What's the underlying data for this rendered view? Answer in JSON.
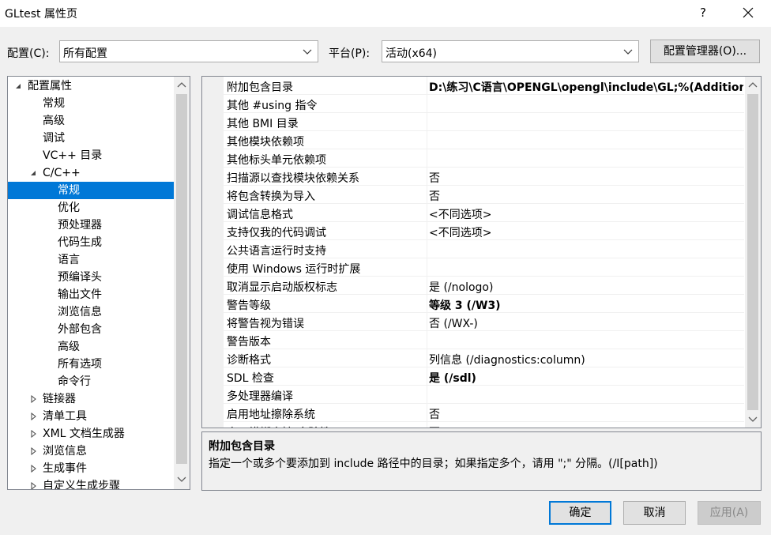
{
  "window": {
    "title": "GLtest 属性页"
  },
  "titlebar": {
    "help": "?"
  },
  "config": {
    "label": "配置(C):",
    "value": "所有配置"
  },
  "platform": {
    "label": "平台(P):",
    "value": "活动(x64)"
  },
  "manager_button": "配置管理器(O)...",
  "tree": {
    "root": "配置属性",
    "items": [
      "常规",
      "高级",
      "调试",
      "VC++ 目录"
    ],
    "cpp": "C/C++",
    "cpp_children": [
      "常规",
      "优化",
      "预处理器",
      "代码生成",
      "语言",
      "预编译头",
      "输出文件",
      "浏览信息",
      "外部包含",
      "高级",
      "所有选项",
      "命令行"
    ],
    "collapsed": [
      "链接器",
      "清单工具",
      "XML 文档生成器",
      "浏览信息",
      "生成事件",
      "自定义生成步骤"
    ]
  },
  "properties": [
    {
      "name": "附加包含目录",
      "value": "D:\\练习\\C语言\\OPENGL\\opengl\\include\\GL;%(AdditionalIncludeDirectories)",
      "bold": true
    },
    {
      "name": "其他 #using 指令",
      "value": ""
    },
    {
      "name": "其他 BMI 目录",
      "value": ""
    },
    {
      "name": "其他模块依赖项",
      "value": ""
    },
    {
      "name": "其他标头单元依赖项",
      "value": ""
    },
    {
      "name": "扫描源以查找模块依赖关系",
      "value": "否"
    },
    {
      "name": "将包含转换为导入",
      "value": "否"
    },
    {
      "name": "调试信息格式",
      "value": "<不同选项>"
    },
    {
      "name": "支持仅我的代码调试",
      "value": "<不同选项>"
    },
    {
      "name": "公共语言运行时支持",
      "value": ""
    },
    {
      "name": "使用 Windows 运行时扩展",
      "value": ""
    },
    {
      "name": "取消显示启动版权标志",
      "value": "是 (/nologo)"
    },
    {
      "name": "警告等级",
      "value": "等级 3 (/W3)",
      "bold": true
    },
    {
      "name": "将警告视为错误",
      "value": "否 (/WX-)"
    },
    {
      "name": "警告版本",
      "value": ""
    },
    {
      "name": "诊断格式",
      "value": "列信息 (/diagnostics:column)"
    },
    {
      "name": "SDL 检查",
      "value": "是 (/sdl)",
      "bold": true
    },
    {
      "name": "多处理器编译",
      "value": ""
    },
    {
      "name": "启用地址擦除系统",
      "value": "否"
    },
    {
      "name": "启用模糊支持(实验性)",
      "value": "否"
    }
  ],
  "description": {
    "title": "附加包含目录",
    "text": "指定一个或多个要添加到 include 路径中的目录；如果指定多个，请用 \";\" 分隔。(/I[path])"
  },
  "buttons": {
    "ok": "确定",
    "cancel": "取消",
    "apply": "应用(A)"
  },
  "colors": {
    "selection": "#0078d7",
    "window_bg": "#f0f0f0"
  }
}
